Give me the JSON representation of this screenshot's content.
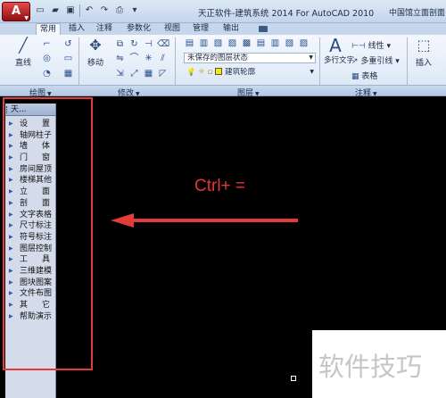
{
  "app": {
    "button_label": "A",
    "title": "天正软件-建筑系统 2014  For AutoCAD 2010",
    "title_right": "中国馆立面剖面"
  },
  "quick_access": [
    "new-icon",
    "open-icon",
    "save-icon",
    "undo-icon",
    "redo-icon",
    "print-icon"
  ],
  "tabs": [
    "常用",
    "插入",
    "注释",
    "参数化",
    "视图",
    "管理",
    "输出"
  ],
  "active_tab": "常用",
  "ribbon": {
    "draw_group": {
      "label": "绘图",
      "line_label": "直线"
    },
    "modify_group": {
      "label": "修改",
      "move_label": "移动"
    },
    "layers_group": {
      "label": "图层",
      "layer_state": "未保存的图层状态",
      "current_layer": "建筑轮廓"
    },
    "annotation_group": {
      "label": "注释",
      "mtext_label": "多行文字",
      "linear_label": "线性",
      "multileader_label": "多重引线",
      "table_label": "表格"
    },
    "block_group": {
      "insert_label": "插入"
    }
  },
  "palette": {
    "title": "天...",
    "items": [
      {
        "label": "设　置",
        "spread": [
          "设",
          "置"
        ]
      },
      {
        "label": "轴网柱子"
      },
      {
        "label": "墙　体",
        "spread": [
          "墙",
          "体"
        ]
      },
      {
        "label": "门　窗",
        "spread": [
          "门",
          "窗"
        ]
      },
      {
        "label": "房间屋顶"
      },
      {
        "label": "楼梯其他"
      },
      {
        "label": "立　面",
        "spread": [
          "立",
          "面"
        ]
      },
      {
        "label": "剖　面",
        "spread": [
          "剖",
          "面"
        ]
      },
      {
        "label": "文字表格"
      },
      {
        "label": "尺寸标注"
      },
      {
        "label": "符号标注"
      },
      {
        "label": "图层控制"
      },
      {
        "label": "工　具",
        "spread": [
          "工",
          "具"
        ]
      },
      {
        "label": "三维建模"
      },
      {
        "label": "图块图案"
      },
      {
        "label": "文件布图"
      },
      {
        "label": "其　它",
        "spread": [
          "其",
          "它"
        ]
      },
      {
        "label": "帮助演示"
      }
    ]
  },
  "canvas": {
    "annotation": "Ctrl+ =",
    "annotation_color": "#e8333a",
    "background": "#000000"
  },
  "watermark": "软件技巧"
}
